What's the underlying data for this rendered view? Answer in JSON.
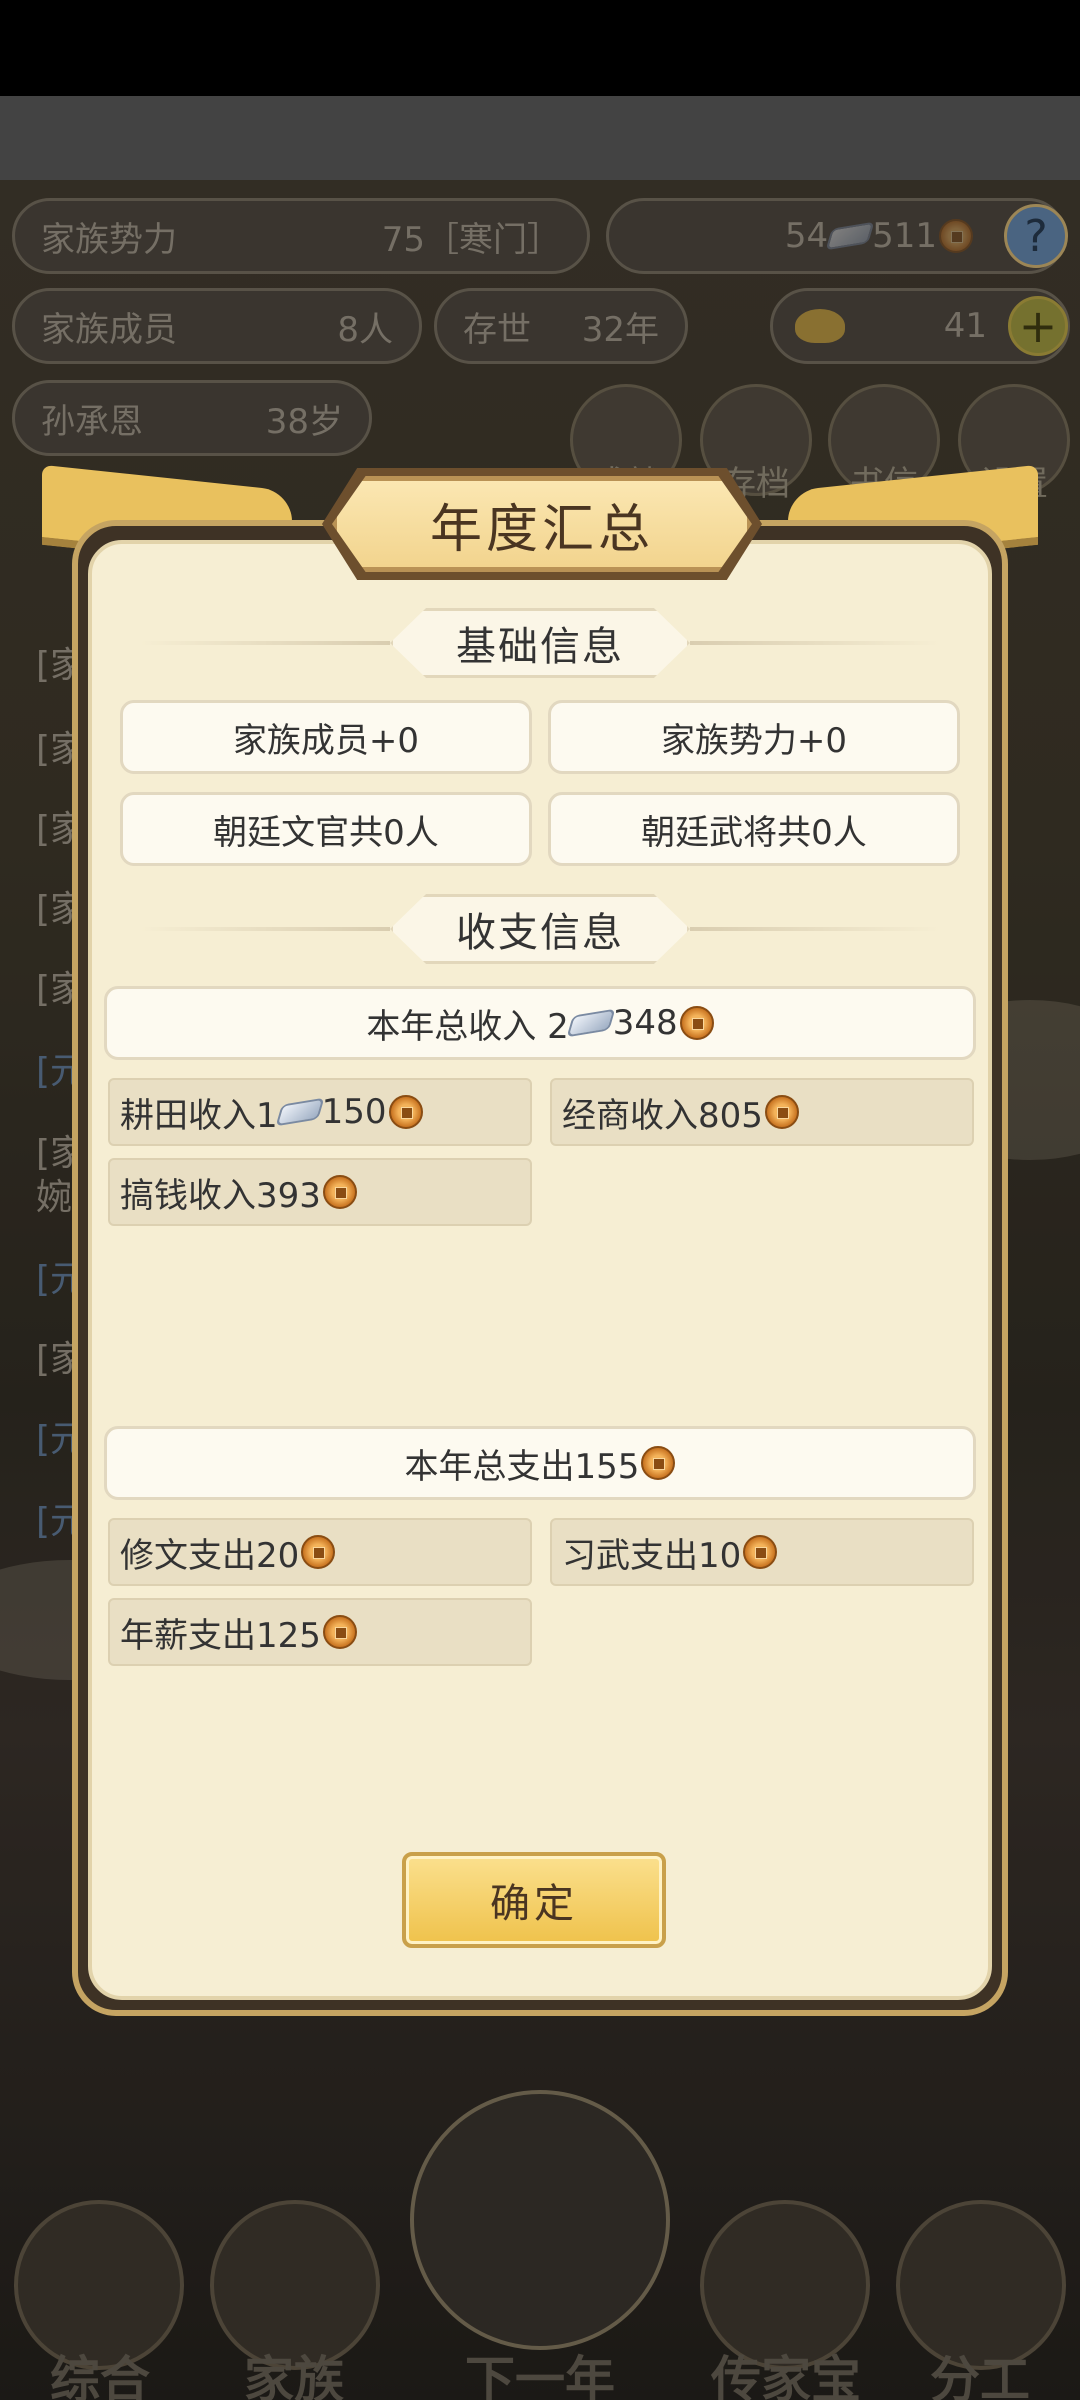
{
  "background": {
    "clan_power_label": "家族势力",
    "clan_power_value": "75［寒门］",
    "silver": "54",
    "copper": "511",
    "help": "?",
    "members_label": "家族成员",
    "members_value": "8人",
    "alive_label": "存世",
    "alive_value": "32年",
    "gold": "41",
    "add": "+",
    "person_name": "孙承恩",
    "person_age": "38岁",
    "icons": [
      "成就",
      "存档",
      "书信",
      "设置"
    ],
    "log_rows": [
      "[家",
      "[家",
      "[家",
      "[家",
      "[家",
      "[元",
      "[家",
      "婉",
      "[元",
      "[家",
      "[元",
      "[元"
    ],
    "nav": [
      "综合",
      "家族",
      "下一年",
      "传家宝",
      "分工"
    ]
  },
  "modal": {
    "title": "年度汇总",
    "basic_section": "基础信息",
    "basic_items": [
      "家族成员+0",
      "家族势力+0",
      "朝廷文官共0人",
      "朝廷武将共0人"
    ],
    "finance_section": "收支信息",
    "income_total_label": "本年总收入 2",
    "income_total_copper": "348",
    "income_items": {
      "farm_label": "耕田收入1",
      "farm_copper": "150",
      "trade": "经商收入805",
      "scheme": "搞钱收入393"
    },
    "expense_total": "本年总支出155",
    "expense_items": {
      "study": "修文支出20",
      "martial": "习武支出10",
      "salary": "年薪支出125"
    },
    "confirm": "确定"
  },
  "colors": {
    "modal_bg": "#f6eed3",
    "frame_gold": "#e9c15e",
    "button_gold": "#efc24b",
    "coin": "#d9832c"
  }
}
